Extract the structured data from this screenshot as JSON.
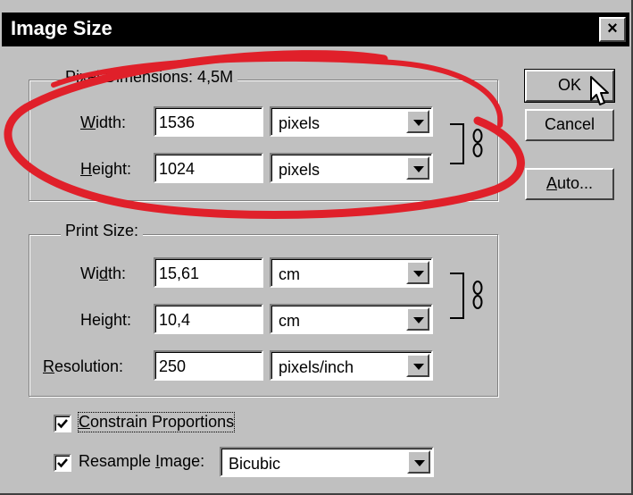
{
  "window": {
    "title": "Image Size",
    "close_glyph": "×"
  },
  "pixel_dimensions": {
    "legend": "Pixel Dimensions:  4,5M",
    "width": {
      "label_pre": "",
      "label_u": "W",
      "label_post": "idth:",
      "value": "1536",
      "unit": "pixels"
    },
    "height": {
      "label_pre": "",
      "label_u": "H",
      "label_post": "eight:",
      "value": "1024",
      "unit": "pixels"
    }
  },
  "print_size": {
    "legend": "Print Size:",
    "width": {
      "label_pre": "Wi",
      "label_u": "d",
      "label_post": "th:",
      "value": "15,61",
      "unit": "cm"
    },
    "height": {
      "label_pre": "Hei",
      "label_u": "g",
      "label_post": "ht:",
      "value": "10,4",
      "unit": "cm"
    },
    "resolution": {
      "label_pre": "",
      "label_u": "R",
      "label_post": "esolution:",
      "value": "250",
      "unit": "pixels/inch"
    }
  },
  "options": {
    "constrain": {
      "label_pre": "",
      "label_u": "C",
      "label_post": "onstrain Proportions",
      "checked": true
    },
    "resample": {
      "label_pre": "Resample ",
      "label_u": "I",
      "label_post": "mage:",
      "checked": true,
      "method": "Bicubic"
    }
  },
  "buttons": {
    "ok": "OK",
    "cancel": "Cancel",
    "auto_u": "A",
    "auto_rest": "uto..."
  },
  "annotation_color": "#e0202a"
}
